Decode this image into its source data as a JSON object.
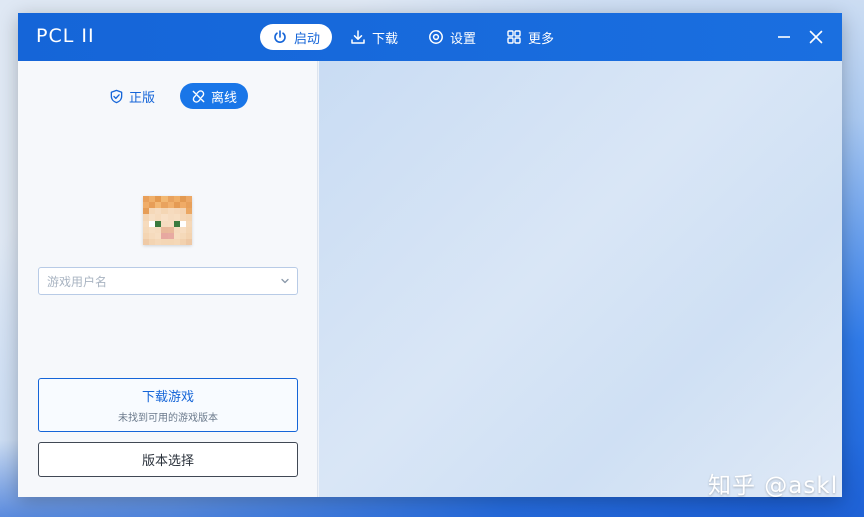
{
  "app": {
    "title": "PCL II"
  },
  "nav": [
    {
      "label": "启动",
      "icon": "power-icon",
      "active": true
    },
    {
      "label": "下载",
      "icon": "download-icon",
      "active": false
    },
    {
      "label": "设置",
      "icon": "gear-icon",
      "active": false
    },
    {
      "label": "更多",
      "icon": "grid-icon",
      "active": false
    }
  ],
  "window_controls": {
    "minimize": "minimize-icon",
    "close": "close-icon"
  },
  "sidebar": {
    "mode_tabs": [
      {
        "label": "正版",
        "icon": "shield-check-icon",
        "active": false
      },
      {
        "label": "离线",
        "icon": "unlink-icon",
        "active": true
      }
    ],
    "avatar": "player-skin-head",
    "username": {
      "placeholder": "游戏用户名",
      "value": ""
    },
    "download_button": {
      "label": "下载游戏",
      "sub_label": "未找到可用的游戏版本"
    },
    "version_button": {
      "label": "版本选择"
    }
  },
  "watermark": "知乎 @askl",
  "colors": {
    "accent": "#1565d8",
    "titlebar": "#1565d8",
    "active_tab": "#1976e8"
  }
}
